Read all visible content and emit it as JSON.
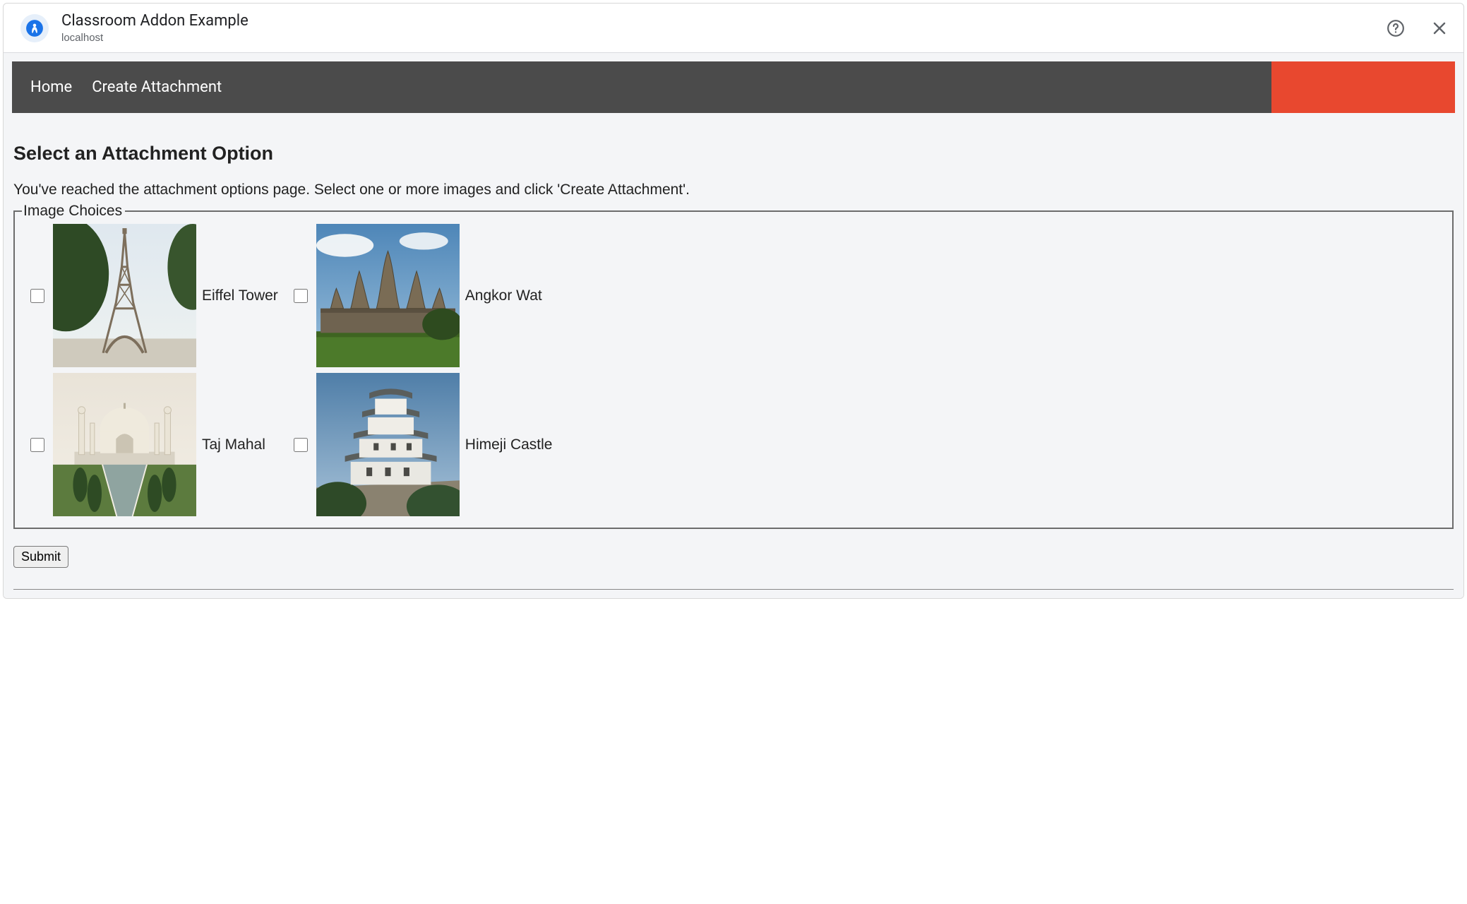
{
  "dialog": {
    "title": "Classroom Addon Example",
    "subtitle": "localhost"
  },
  "nav": {
    "items": [
      "Home",
      "Create Attachment"
    ]
  },
  "page": {
    "heading": "Select an Attachment Option",
    "intro": "You've reached the attachment options page. Select one or more images and click 'Create Attachment'.",
    "fieldset_legend": "Image Choices",
    "options": [
      {
        "label": "Eiffel Tower"
      },
      {
        "label": "Angkor Wat"
      },
      {
        "label": "Taj Mahal"
      },
      {
        "label": "Himeji Castle"
      }
    ],
    "submit_label": "Submit"
  }
}
